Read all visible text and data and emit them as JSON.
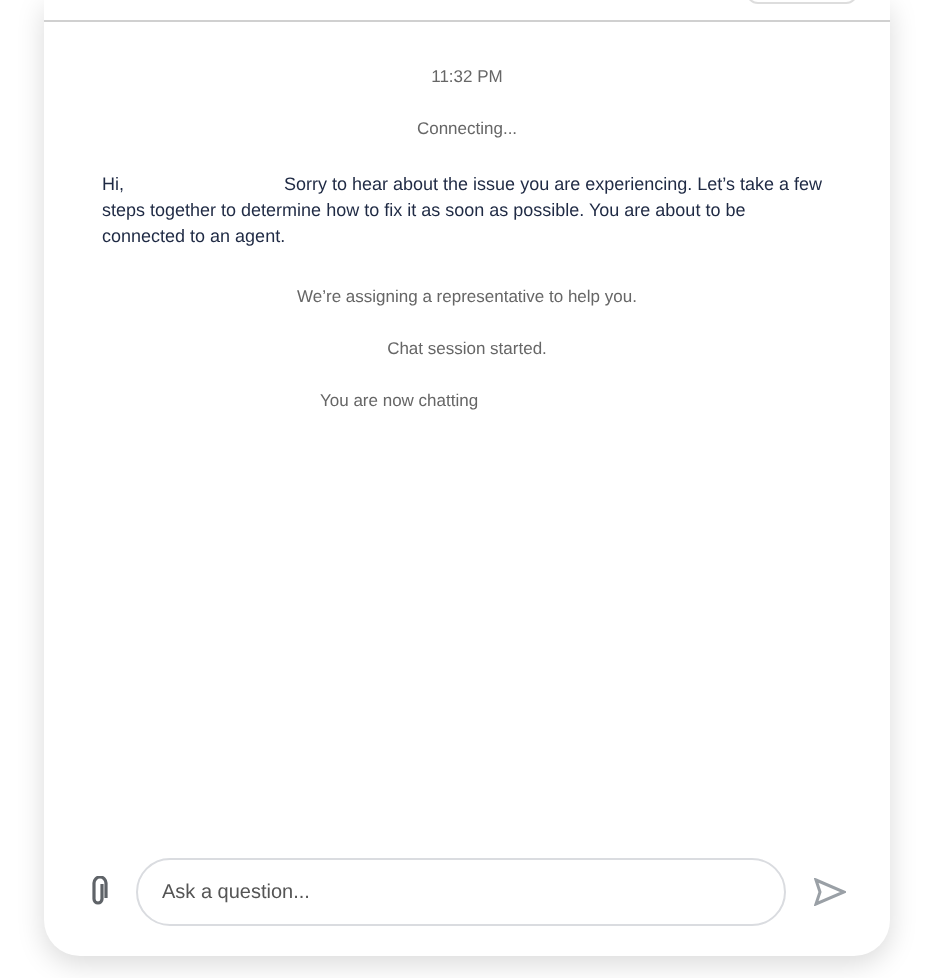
{
  "messages": [
    {
      "kind": "system",
      "text": "11:32 PM"
    },
    {
      "kind": "system",
      "text": "Connecting..."
    },
    {
      "kind": "bot",
      "greeting": "Hi,",
      "text": "Sorry to hear about the issue you are experiencing. Let’s take a few steps together to determine how to fix it as soon as possible. You are about to be connected to an agent."
    },
    {
      "kind": "system",
      "text": "We’re assigning a representative to help you."
    },
    {
      "kind": "system",
      "text": "Chat session started."
    },
    {
      "kind": "status",
      "text": "You are now chatting"
    }
  ],
  "composer": {
    "placeholder": "Ask a question..."
  }
}
